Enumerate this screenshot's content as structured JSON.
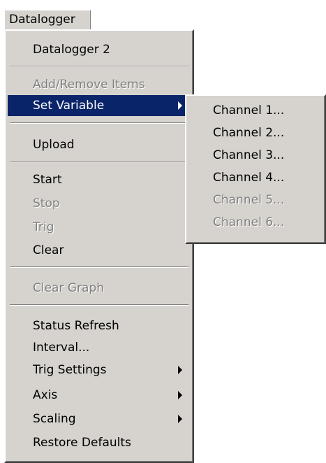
{
  "menubar": {
    "title": "Datalogger"
  },
  "menu": {
    "items": [
      {
        "label": "Datalogger 2",
        "enabled": true
      },
      {
        "label": "Add/Remove Items",
        "enabled": false
      },
      {
        "label": "Set Variable",
        "enabled": true,
        "highlighted": true,
        "submenu": true
      },
      {
        "label": "Upload",
        "enabled": true
      },
      {
        "label": "Start",
        "enabled": true
      },
      {
        "label": "Stop",
        "enabled": false
      },
      {
        "label": "Trig",
        "enabled": false
      },
      {
        "label": "Clear",
        "enabled": true
      },
      {
        "label": "Clear Graph",
        "enabled": false
      },
      {
        "label": "Status Refresh",
        "enabled": true
      },
      {
        "label": "Interval...",
        "enabled": true
      },
      {
        "label": "Trig Settings",
        "enabled": true,
        "submenu": true
      },
      {
        "label": "Axis",
        "enabled": true,
        "submenu": true
      },
      {
        "label": "Scaling",
        "enabled": true,
        "submenu": true
      },
      {
        "label": "Restore Defaults",
        "enabled": true
      }
    ]
  },
  "submenu": {
    "items": [
      {
        "label": "Channel 1...",
        "enabled": true
      },
      {
        "label": "Channel 2...",
        "enabled": true
      },
      {
        "label": "Channel 3...",
        "enabled": true
      },
      {
        "label": "Channel 4...",
        "enabled": true
      },
      {
        "label": "Channel 5...",
        "enabled": false
      },
      {
        "label": "Channel 6...",
        "enabled": false
      }
    ]
  },
  "colors": {
    "menu_background": "#d6d3ce",
    "highlight": "#0a246a",
    "disabled_text": "#808080"
  }
}
